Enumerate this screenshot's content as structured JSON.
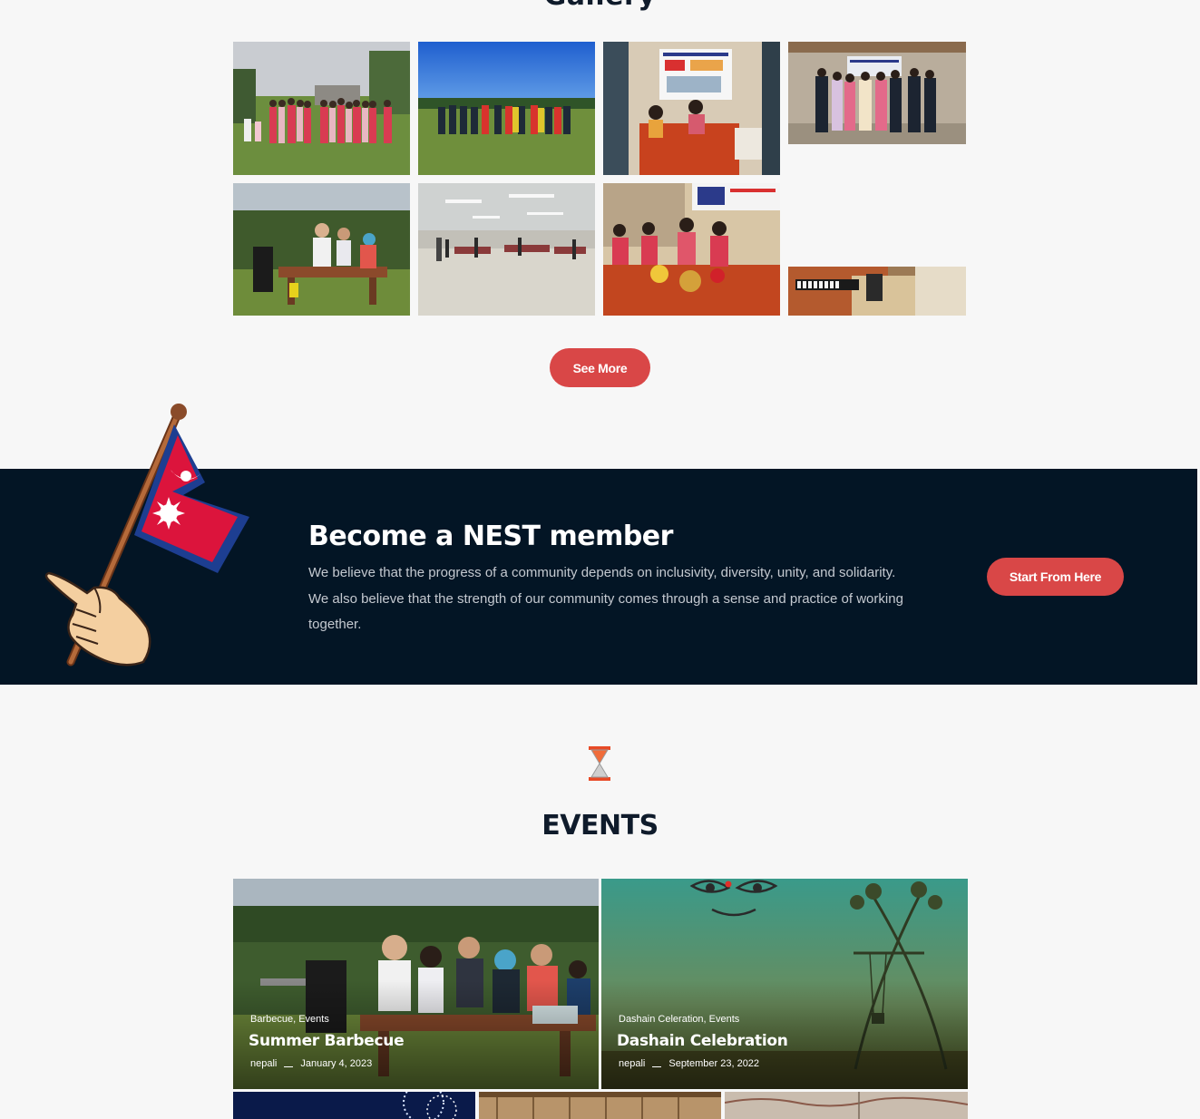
{
  "gallery": {
    "title": "Gallery",
    "photos": [
      {
        "name": "gallery-photo-women-group"
      },
      {
        "name": "gallery-photo-soccer-team"
      },
      {
        "name": "gallery-photo-info-booth"
      },
      {
        "name": "gallery-photo-formal-group"
      },
      {
        "name": "gallery-photo-barbecue"
      },
      {
        "name": "gallery-photo-hall"
      },
      {
        "name": "gallery-photo-ladies-table"
      },
      {
        "name": "gallery-photo-keyboard"
      }
    ],
    "see_more_label": "See More"
  },
  "member": {
    "title": "Become a NEST member",
    "description": "We believe that the progress of a community depends on inclusivity, diversity, unity, and solidarity. We also believe that the strength of our community comes through a sense and practice of working together.",
    "cta_label": "Start From Here"
  },
  "events": {
    "title": "EVENTS",
    "cards": [
      {
        "categories": "Barbecue, Events",
        "title": "Summer Barbecue",
        "author": "nepali",
        "date": "January 4, 2023"
      },
      {
        "categories": "Dashain Celeration, Events",
        "title": "Dashain Celebration",
        "author": "nepali",
        "date": "September 23, 2022"
      }
    ]
  },
  "colors": {
    "accent": "#d94747",
    "dark_band": "#031525",
    "heading": "#0f1b2b",
    "background": "#f7f7f7"
  },
  "icons": {
    "hourglass": "hourglass-icon",
    "flag": "nepal-flag-illustration"
  }
}
